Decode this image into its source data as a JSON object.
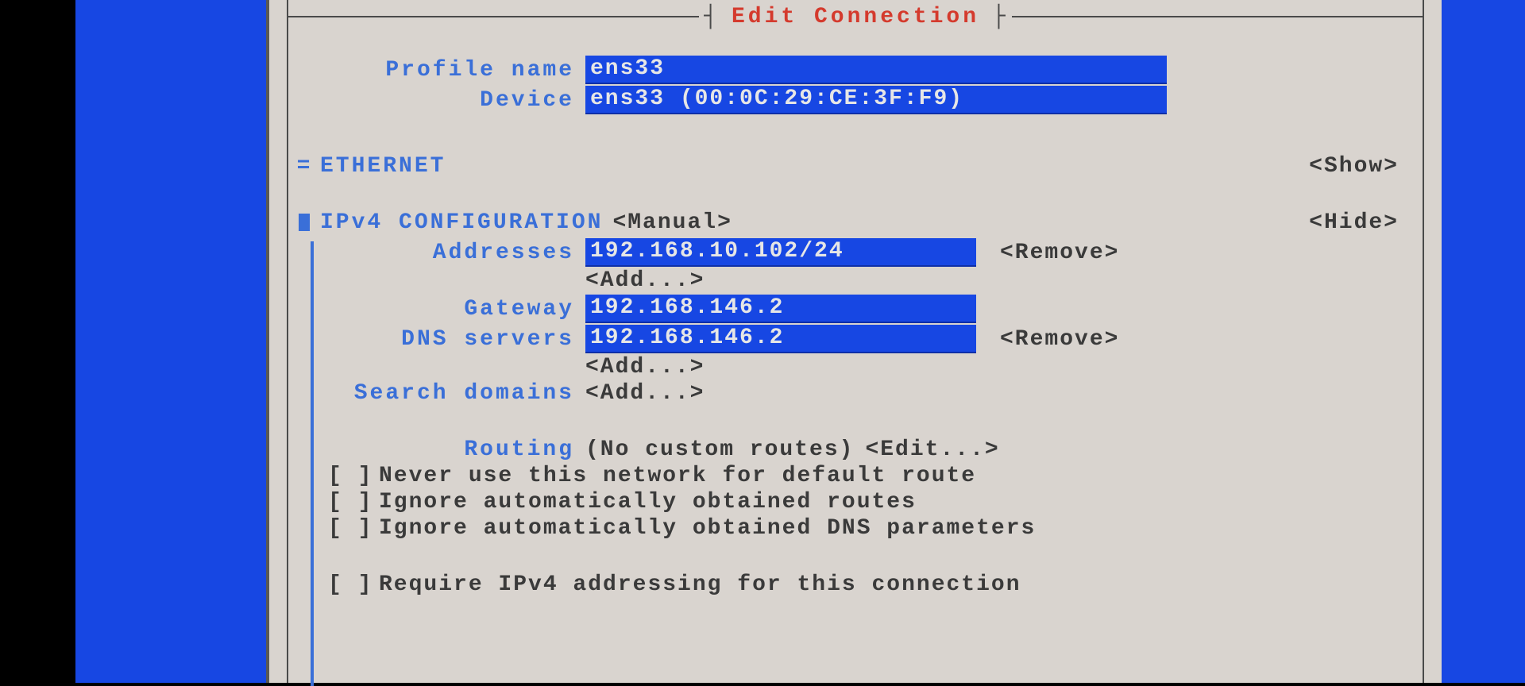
{
  "dialog": {
    "title": "Edit Connection",
    "profile_name_label": "Profile name",
    "profile_name_value": "ens33",
    "device_label": "Device",
    "device_value": "ens33 (00:0C:29:CE:3F:F9)"
  },
  "ethernet": {
    "header": "ETHERNET",
    "marker": "=",
    "toggle": "<Show>"
  },
  "ipv4": {
    "header": "IPv4 CONFIGURATION",
    "mode": "<Manual>",
    "toggle": "<Hide>",
    "addresses_label": "Addresses",
    "addresses": [
      "192.168.10.102/24"
    ],
    "add_label": "<Add...>",
    "remove_label": "<Remove>",
    "gateway_label": "Gateway",
    "gateway_value": "192.168.146.2",
    "dns_label": "DNS servers",
    "dns_servers": [
      "192.168.146.2"
    ],
    "search_domains_label": "Search domains",
    "routing_label": "Routing",
    "routing_value": "(No custom routes)",
    "routing_edit": "<Edit...>",
    "checkbox_unchecked": "[ ]",
    "chk_never_default": "Never use this network for default route",
    "chk_ignore_routes": "Ignore automatically obtained routes",
    "chk_ignore_dns": "Ignore automatically obtained DNS parameters",
    "chk_require_ipv4": "Require IPv4 addressing for this connection"
  }
}
